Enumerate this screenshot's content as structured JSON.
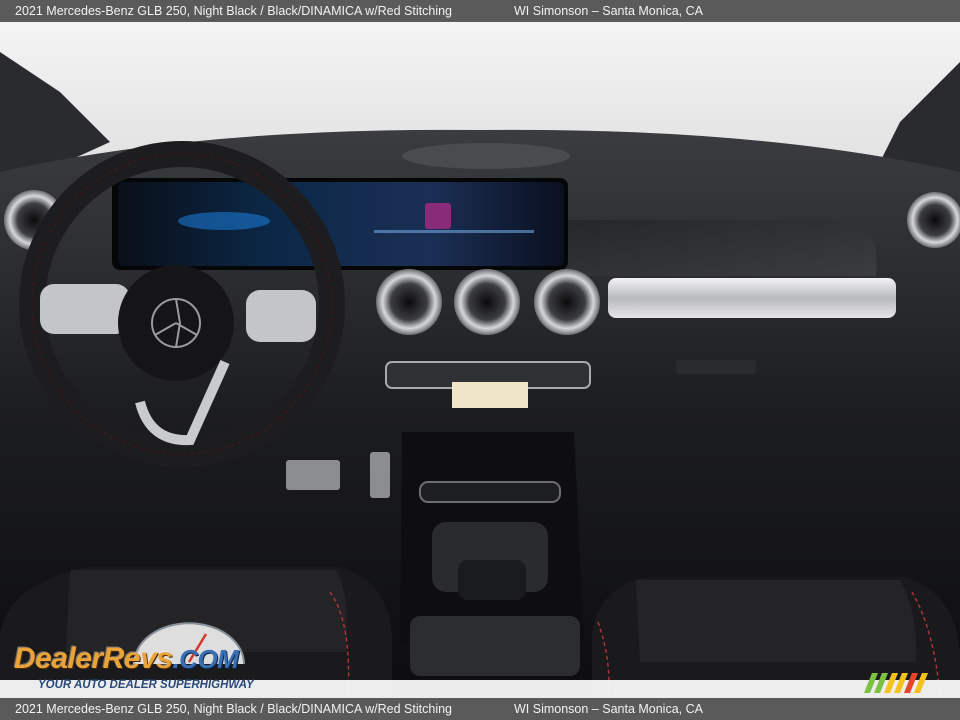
{
  "header": {
    "vehicle": "2021 Mercedes-Benz GLB 250,  Night Black  / Black/DINAMICA w/Red Stitching",
    "dealer": "WI Simonson – Santa Monica, CA"
  },
  "footer": {
    "vehicle": "2021 Mercedes-Benz GLB 250,  Night Black  / Black/DINAMICA w/Red Stitching",
    "dealer": "WI Simonson – Santa Monica, CA"
  },
  "watermark": {
    "brand": "DealerRevs",
    "domain": ".COM",
    "tagline": "YOUR AUTO DEALER SUPERHIGHWAY",
    "colors": {
      "brand": "#e9a33a",
      "domain": "#3a6fb3",
      "tagline": "#2b4a7a",
      "stripes": [
        "#7cc142",
        "#f4c21a",
        "#e8462a"
      ]
    }
  },
  "photo": {
    "subject": "car-interior-dashboard",
    "colors": {
      "dash": "#202124",
      "seat": "#1a1a1c",
      "stitch": "#b3343a",
      "trim": "#c9c9cc",
      "screen": "#0a1a2e"
    }
  }
}
